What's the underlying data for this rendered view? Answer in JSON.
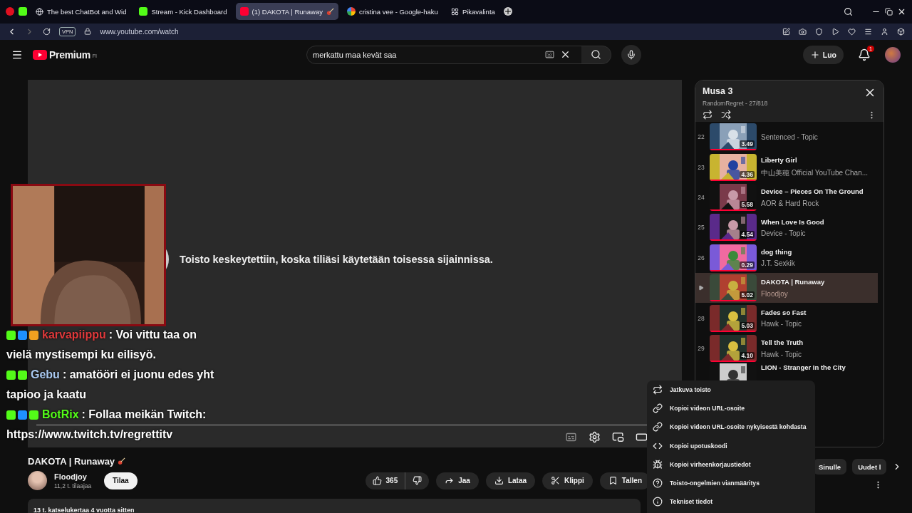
{
  "browser": {
    "tabs": [
      {
        "title": "The best ChatBot and Wid",
        "selected": false
      },
      {
        "title": "Stream - Kick Dashboard",
        "selected": false
      },
      {
        "title": "(1) DAKOTA | Runaway",
        "selected": true
      },
      {
        "title": "cristina vee - Google-haku",
        "selected": false
      },
      {
        "title": "Pikavalinta",
        "selected": false
      }
    ],
    "vpn": "VPN",
    "address": "www.youtube.com/watch"
  },
  "header": {
    "logo": "Premium",
    "region": "FI",
    "search": {
      "value": "merkattu maa kevät saa"
    },
    "create": "Luo",
    "notifications": "1"
  },
  "player": {
    "message": "Toisto keskeytettiin, koska tiliäsi käytetään toisessa sijainnissa."
  },
  "chat": [
    {
      "user": "karvapiippu",
      "color": "#e0393b",
      "lines": [
        ": Voi vittu taa on",
        "vielä mystisempi ku eilisyö."
      ]
    },
    {
      "user": "Gebu",
      "color": "#a9c8f0",
      "lines": [
        ": amatööri ei juonu edes yht",
        "tapioo ja kaatu"
      ]
    },
    {
      "user": "BotRix",
      "color": "#53fc18",
      "lines": [
        ": Follaa meikän Twitch:",
        "https://www.twitch.tv/regrettitv"
      ]
    }
  ],
  "video": {
    "title": "DAKOTA | Runaway",
    "channel": "Floodjoy",
    "subscribers": "11,2 t. tilaajaa",
    "subscribe": "Tilaa",
    "likes": "365",
    "actions": [
      "Jaa",
      "Lataa",
      "Klippi",
      "Tallen"
    ],
    "description": "13 t. katselukertaa  4 vuotta sitten"
  },
  "playlist": {
    "title": "Musa 3",
    "meta": "RandomRegret - 27/818",
    "items": [
      {
        "index": "22",
        "channel": "Sentenced - Topic",
        "duration": "3.49",
        "selected": false
      },
      {
        "index": "23",
        "title": "Liberty Girl",
        "channel": "中山美穂 Official YouTube Chan...",
        "duration": "4.36",
        "selected": false
      },
      {
        "index": "24",
        "title": "Device – Pieces On The Ground",
        "channel": "AOR & Hard Rock",
        "duration": "5.58",
        "selected": false
      },
      {
        "index": "25",
        "title": "When Love Is Good",
        "channel": "Device - Topic",
        "duration": "4.54",
        "selected": false
      },
      {
        "index": "26",
        "title": "dog thing",
        "channel": "J.T. Sexkik",
        "duration": "0.29",
        "selected": false
      },
      {
        "title": "DAKOTA | Runaway",
        "channel": "Floodjoy",
        "duration": "5.02",
        "selected": true
      },
      {
        "index": "28",
        "title": "Fades so Fast",
        "channel": "Hawk - Topic",
        "duration": "5.03",
        "selected": false
      },
      {
        "index": "29",
        "title": "Tell the Truth",
        "channel": "Hawk - Topic",
        "duration": "4.10",
        "selected": false
      },
      {
        "title": "LION - Stranger In the City",
        "selected": false
      }
    ]
  },
  "chips": [
    "Sinulle",
    "Uudet l"
  ],
  "menu": [
    "Jatkuva toisto",
    "Kopioi videon URL-osoite",
    "Kopioi videon URL-osoite nykyisestä kohdasta",
    "Kopioi upotuskoodi",
    "Kopioi virheenkorjaustiedot",
    "Toisto-ongelmien vianmääritys",
    "Tekniset tiedot"
  ]
}
